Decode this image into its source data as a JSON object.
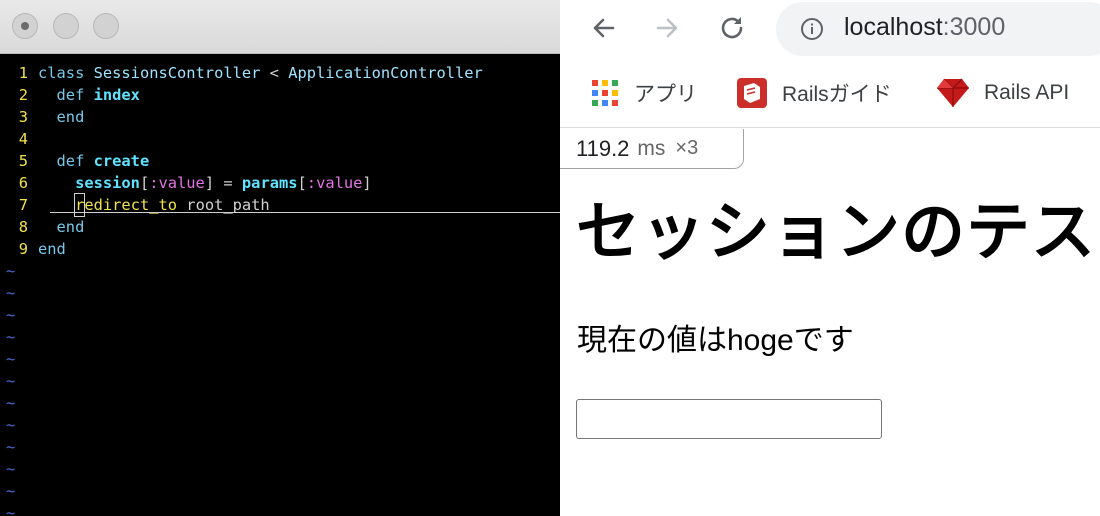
{
  "terminal": {
    "code_lines": [
      {
        "num": "1",
        "tokens": [
          {
            "t": "class ",
            "c": "kw"
          },
          {
            "t": "SessionsController",
            "c": "cls"
          },
          {
            "t": " < ",
            "c": "plain"
          },
          {
            "t": "ApplicationController",
            "c": "cls"
          }
        ]
      },
      {
        "num": "2",
        "tokens": [
          {
            "t": "  def ",
            "c": "kw"
          },
          {
            "t": "index",
            "c": "fn"
          }
        ]
      },
      {
        "num": "3",
        "tokens": [
          {
            "t": "  end",
            "c": "kw"
          }
        ]
      },
      {
        "num": "4",
        "tokens": []
      },
      {
        "num": "5",
        "tokens": [
          {
            "t": "  def ",
            "c": "kw"
          },
          {
            "t": "create",
            "c": "fn"
          }
        ]
      },
      {
        "num": "6",
        "tokens": [
          {
            "t": "    session",
            "c": "fn"
          },
          {
            "t": "[",
            "c": "plain"
          },
          {
            "t": ":value",
            "c": "sym"
          },
          {
            "t": "] = ",
            "c": "plain"
          },
          {
            "t": "params",
            "c": "fn"
          },
          {
            "t": "[",
            "c": "plain"
          },
          {
            "t": ":value",
            "c": "sym"
          },
          {
            "t": "]",
            "c": "plain"
          }
        ]
      },
      {
        "num": "7",
        "tokens": [
          {
            "t": "    ",
            "c": "plain"
          },
          {
            "t": "r",
            "c": "call cursor-box"
          },
          {
            "t": "edirect_to",
            "c": "call"
          },
          {
            "t": " root_path",
            "c": "plain"
          }
        ]
      },
      {
        "num": "8",
        "tokens": [
          {
            "t": "  end",
            "c": "kw"
          }
        ]
      },
      {
        "num": "9",
        "tokens": [
          {
            "t": "end",
            "c": "kw"
          }
        ]
      }
    ],
    "tilde_char": "~",
    "tilde_count": 12
  },
  "browser": {
    "url_host": "localhost",
    "url_port": ":3000",
    "bookmarks": [
      {
        "label": "アプリ",
        "icon": "apps-grid-icon"
      },
      {
        "label": "Railsガイド",
        "icon": "rails-guide-icon"
      },
      {
        "label": "Rails API",
        "icon": "ruby-icon"
      }
    ],
    "perf": {
      "value": "119.2",
      "unit": "ms",
      "multiplier": "×3"
    },
    "page": {
      "heading": "セッションのテスト",
      "current_value_text": "現在の値はhogeです",
      "input_value": ""
    }
  },
  "colors": {
    "terminal_bg": "#000000",
    "line_number": "#f2e24a",
    "keyword": "#75c8ea",
    "symbol": "#e274e6",
    "tilde": "#4d6bd6"
  }
}
